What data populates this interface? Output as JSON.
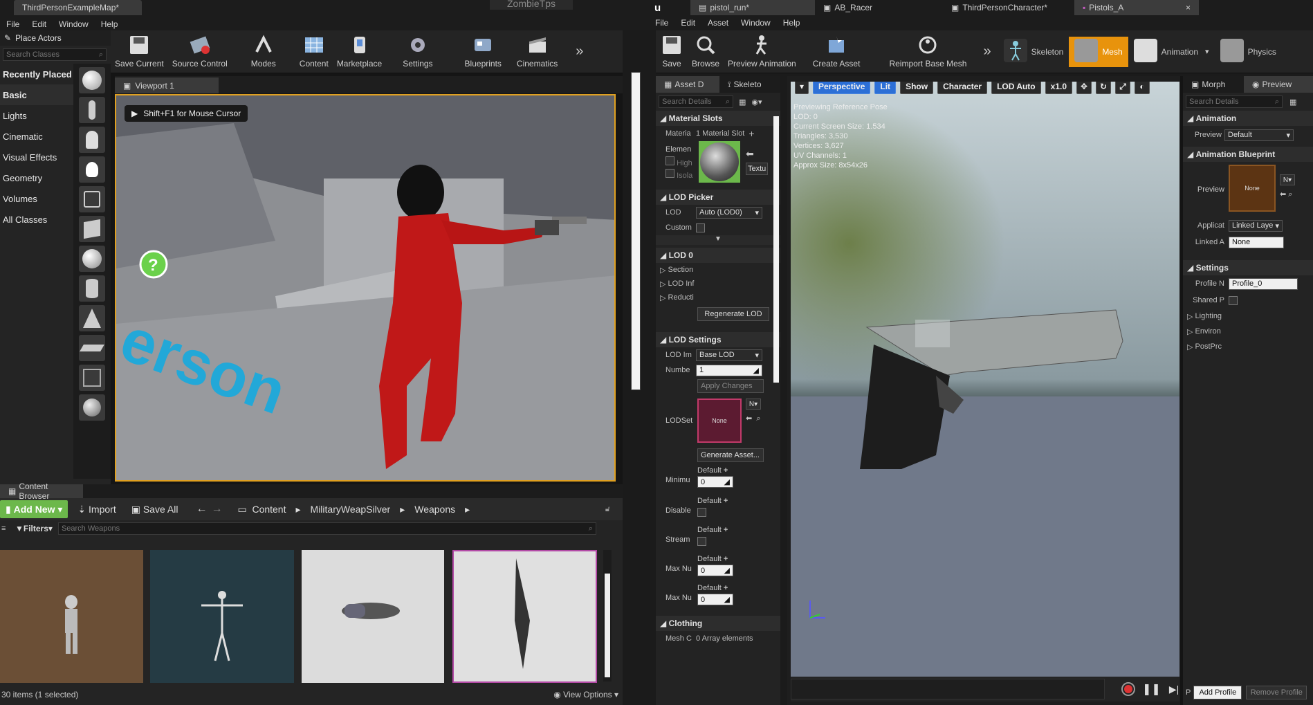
{
  "left_window": {
    "tabs": [
      "ThirdPersonExampleMap*",
      "ZombieTps"
    ],
    "menu": [
      "File",
      "Edit",
      "Window",
      "Help"
    ],
    "toolbar": [
      "Save Current",
      "Source Control",
      "Modes",
      "Content",
      "Marketplace",
      "Settings",
      "Blueprints",
      "Cinematics"
    ],
    "place_actors": {
      "title": "Place Actors",
      "search_placeholder": "Search Classes",
      "categories": [
        "Recently Placed",
        "Basic",
        "Lights",
        "Cinematic",
        "Visual Effects",
        "Geometry",
        "Volumes",
        "All Classes"
      ]
    },
    "viewport": {
      "tab": "Viewport 1",
      "hint": "Shift+F1 for Mouse Cursor",
      "floor_text": "erson"
    },
    "content_browser": {
      "title": "Content Browser",
      "add_new": "Add New",
      "import": "Import",
      "save_all": "Save All",
      "breadcrumb": [
        "Content",
        "MilitaryWeapSilver",
        "Weapons"
      ],
      "filters": "Filters",
      "search_placeholder": "Search Weapons",
      "status": "30 items (1 selected)",
      "view_options": "View Options"
    }
  },
  "right_window": {
    "tabs": [
      "pistol_run*",
      "AB_Racer",
      "ThirdPersonCharacter*",
      "Pistols_A"
    ],
    "menu": [
      "File",
      "Edit",
      "Asset",
      "Window",
      "Help"
    ],
    "toolbar": [
      "Save",
      "Browse",
      "Preview Animation",
      "Create Asset",
      "Reimport Base Mesh"
    ],
    "modes": [
      "Skeleton",
      "Mesh",
      "Animation",
      "Physics"
    ],
    "details": {
      "tabs": [
        "Asset D",
        "Skeleto"
      ],
      "search_placeholder": "Search Details",
      "sections": {
        "material_slots": "Material Slots",
        "material_label": "Materia",
        "material_count": "1 Material Slot",
        "element_label": "Elemen",
        "high_label": "High",
        "isola_label": "Isola",
        "textu_btn": "Textu",
        "lod_picker": "LOD Picker",
        "lod_label": "LOD",
        "lod_value": "Auto (LOD0)",
        "custom_label": "Custom",
        "lod0": "LOD 0",
        "lod0_items": [
          "Section",
          "LOD Inf",
          "Reducti"
        ],
        "regenerate": "Regenerate LOD",
        "lod_settings": "LOD Settings",
        "lod_import_label": "LOD Im",
        "lod_import_value": "Base LOD",
        "number_label": "Numbe",
        "number_value": "1",
        "apply_changes": "Apply Changes",
        "lodset_label": "LODSet",
        "none": "None",
        "generate_asset": "Generate Asset...",
        "minimu_label": "Minimu",
        "disable_label": "Disable",
        "stream_label": "Stream",
        "maxnu_label": "Max Nu",
        "default_label": "Default",
        "zero": "0",
        "clothing": "Clothing",
        "mesh_c_label": "Mesh C",
        "mesh_c_value": "0 Array elements"
      }
    },
    "viewport": {
      "buttons": [
        "Perspective",
        "Lit",
        "Show",
        "Character",
        "LOD Auto",
        "x1.0"
      ],
      "stats": [
        "Previewing Reference Pose",
        "LOD: 0",
        "Current Screen Size: 1.534",
        "Triangles: 3,530",
        "Vertices: 3,627",
        "UV Channels: 1",
        "Approx Size: 8x54x26"
      ]
    },
    "preview_panel": {
      "tabs": [
        "Morph",
        "Preview"
      ],
      "search_placeholder": "Search Details",
      "animation": "Animation",
      "preview_label": "Preview",
      "preview_value": "Default",
      "anim_bp": "Animation Blueprint",
      "bp_preview_label": "Preview",
      "none": "None",
      "n_btn": "N",
      "applicat_label": "Applicat",
      "applicat_value": "Linked Laye",
      "linked_label": "Linked A",
      "linked_value": "None",
      "settings": "Settings",
      "profile_label": "Profile N",
      "profile_value": "Profile_0",
      "shared_label": "Shared P",
      "sub_items": [
        "Lighting",
        "Environ",
        "PostPrc"
      ],
      "add_profile": "Add Profile",
      "remove_profile": "Remove Profile"
    }
  },
  "colors": {
    "accent": "#e8930c",
    "select": "#2b6fd6",
    "viewport_border": "#e0a020",
    "lit_blue": "#2c6fd6"
  }
}
